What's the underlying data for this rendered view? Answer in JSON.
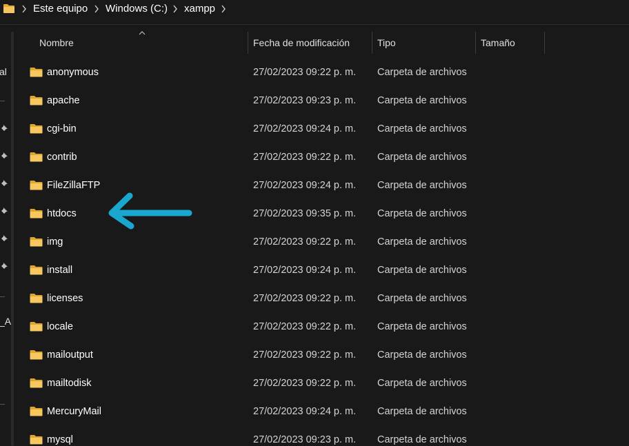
{
  "breadcrumb": {
    "items": [
      "Este equipo",
      "Windows (C:)",
      "xampp"
    ]
  },
  "nav_fragments": {
    "frag1": "al",
    "frag2": "_A"
  },
  "columns": {
    "name": "Nombre",
    "date": "Fecha de modificación",
    "type": "Tipo",
    "size": "Tamaño"
  },
  "files": [
    {
      "name": "anonymous",
      "date": "27/02/2023 09:22 p. m.",
      "type": "Carpeta de archivos"
    },
    {
      "name": "apache",
      "date": "27/02/2023 09:23 p. m.",
      "type": "Carpeta de archivos"
    },
    {
      "name": "cgi-bin",
      "date": "27/02/2023 09:24 p. m.",
      "type": "Carpeta de archivos"
    },
    {
      "name": "contrib",
      "date": "27/02/2023 09:22 p. m.",
      "type": "Carpeta de archivos"
    },
    {
      "name": "FileZillaFTP",
      "date": "27/02/2023 09:24 p. m.",
      "type": "Carpeta de archivos"
    },
    {
      "name": "htdocs",
      "date": "27/02/2023 09:35 p. m.",
      "type": "Carpeta de archivos"
    },
    {
      "name": "img",
      "date": "27/02/2023 09:22 p. m.",
      "type": "Carpeta de archivos"
    },
    {
      "name": "install",
      "date": "27/02/2023 09:24 p. m.",
      "type": "Carpeta de archivos"
    },
    {
      "name": "licenses",
      "date": "27/02/2023 09:22 p. m.",
      "type": "Carpeta de archivos"
    },
    {
      "name": "locale",
      "date": "27/02/2023 09:22 p. m.",
      "type": "Carpeta de archivos"
    },
    {
      "name": "mailoutput",
      "date": "27/02/2023 09:22 p. m.",
      "type": "Carpeta de archivos"
    },
    {
      "name": "mailtodisk",
      "date": "27/02/2023 09:22 p. m.",
      "type": "Carpeta de archivos"
    },
    {
      "name": "MercuryMail",
      "date": "27/02/2023 09:24 p. m.",
      "type": "Carpeta de archivos"
    },
    {
      "name": "mysql",
      "date": "27/02/2023 09:23 p. m.",
      "type": "Carpeta de archivos"
    }
  ],
  "icons": {
    "folder": "folder-icon",
    "chevron": "chevron-right-icon",
    "pin": "pin-icon",
    "sort": "sort-ascending-icon",
    "annotation": "arrow-left-annotation"
  },
  "colors": {
    "background": "#191919",
    "folder": "#f2c55c",
    "annotation_arrow": "#1aa7cf",
    "text": "#ffffff"
  }
}
